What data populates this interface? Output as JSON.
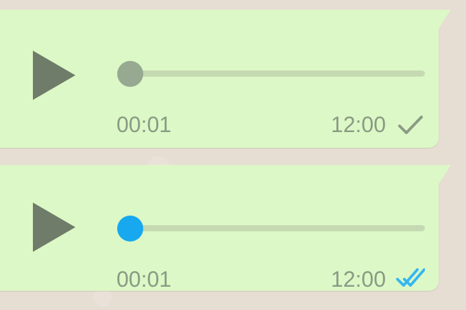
{
  "colors": {
    "wallpaper": "#e6ddd3",
    "bubble_outgoing": "#dcf8c6",
    "play_icon": "#6f7c69",
    "track": "#c5d9b3",
    "meta_text": "#8a9a84",
    "knob_unplayed": "#98a992",
    "knob_played_receipt": "#18a8ef",
    "read_receipt": "#34b7f1"
  },
  "messages": [
    {
      "kind": "voice-note",
      "duration": "00:01",
      "time": "12:00",
      "status": "sent",
      "knob_color": "#98a992",
      "status_icon": "single-check-icon",
      "playback_progress": 0.0
    },
    {
      "kind": "voice-note",
      "duration": "00:01",
      "time": "12:00",
      "status": "read",
      "knob_color": "#18a8ef",
      "status_icon": "double-check-icon",
      "playback_progress": 0.0
    }
  ]
}
